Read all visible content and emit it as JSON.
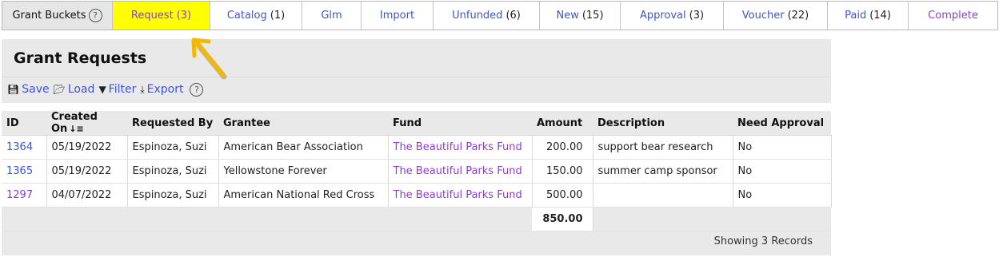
{
  "tabs": {
    "title": "Grant Buckets",
    "help_glyph": "?",
    "items": [
      {
        "label": "Request",
        "count": "(3)"
      },
      {
        "label": "Catalog",
        "count": "(1)"
      },
      {
        "label": "Glm",
        "count": ""
      },
      {
        "label": "Import",
        "count": ""
      },
      {
        "label": "Unfunded",
        "count": "(6)"
      },
      {
        "label": "New",
        "count": "(15)"
      },
      {
        "label": "Approval",
        "count": "(3)"
      },
      {
        "label": "Voucher",
        "count": "(22)"
      },
      {
        "label": "Paid",
        "count": "(14)"
      },
      {
        "label": "Complete",
        "count": ""
      }
    ]
  },
  "panel": {
    "title": "Grant Requests",
    "toolbar": {
      "save": "Save",
      "load": "Load",
      "filter": "Filter",
      "export": "Export",
      "help": "?"
    }
  },
  "table": {
    "columns": [
      "ID",
      "Created On",
      "Requested By",
      "Grantee",
      "Fund",
      "Amount",
      "Description",
      "Need Approval"
    ],
    "rows": [
      {
        "id": "1364",
        "created": "05/19/2022",
        "requested_by": "Espinoza, Suzi",
        "grantee": "American Bear Association",
        "fund": "The Beautiful Parks Fund",
        "amount": "200.00",
        "description": "support bear research",
        "need_approval": "No"
      },
      {
        "id": "1365",
        "created": "05/19/2022",
        "requested_by": "Espinoza, Suzi",
        "grantee": "Yellowstone Forever",
        "fund": "The Beautiful Parks Fund",
        "amount": "150.00",
        "description": "summer camp sponsor",
        "need_approval": "No"
      },
      {
        "id": "1297",
        "created": "04/07/2022",
        "requested_by": "Espinoza, Suzi",
        "grantee": "American National Red Cross",
        "fund": "The Beautiful Parks Fund",
        "amount": "500.00",
        "description": "",
        "need_approval": "No"
      }
    ],
    "total": "850.00",
    "footer": "Showing 3 Records"
  },
  "colors": {
    "active_tab": "#ffff00",
    "link": "#3d55d6",
    "visited_link": "#8b3fd0",
    "arrow": "#f5b800"
  }
}
